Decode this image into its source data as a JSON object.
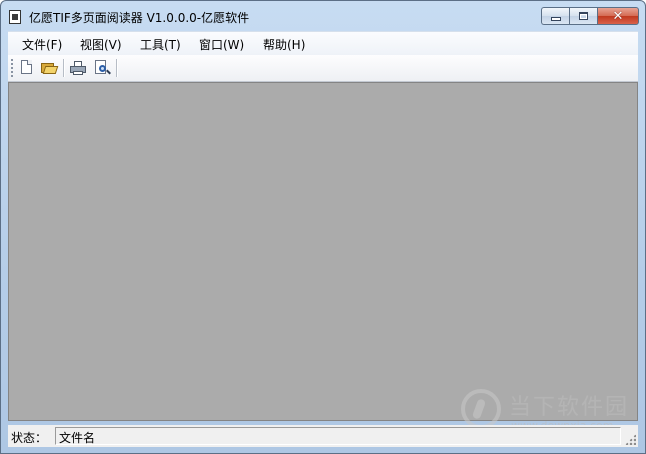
{
  "window": {
    "title": "亿愿TIF多页面阅读器 V1.0.0.0-亿愿软件",
    "minimize_label": "",
    "maximize_label": "",
    "close_label": "✕"
  },
  "menu": {
    "items": [
      {
        "label": "文件(F)"
      },
      {
        "label": "视图(V)"
      },
      {
        "label": "工具(T)"
      },
      {
        "label": "窗口(W)"
      },
      {
        "label": "帮助(H)"
      }
    ]
  },
  "toolbar": {
    "buttons": [
      {
        "icon": "new-document-icon"
      },
      {
        "icon": "open-folder-icon"
      },
      {
        "icon": "print-icon"
      },
      {
        "icon": "print-preview-icon"
      }
    ]
  },
  "statusbar": {
    "label": "状态：",
    "value": "文件名"
  },
  "watermark": {
    "text": "当下软件园",
    "url": "www.downxia.com"
  },
  "colors": {
    "client_background": "#ababab",
    "title_gradient_top": "#c7dcf2",
    "close_button": "#c0391f"
  }
}
